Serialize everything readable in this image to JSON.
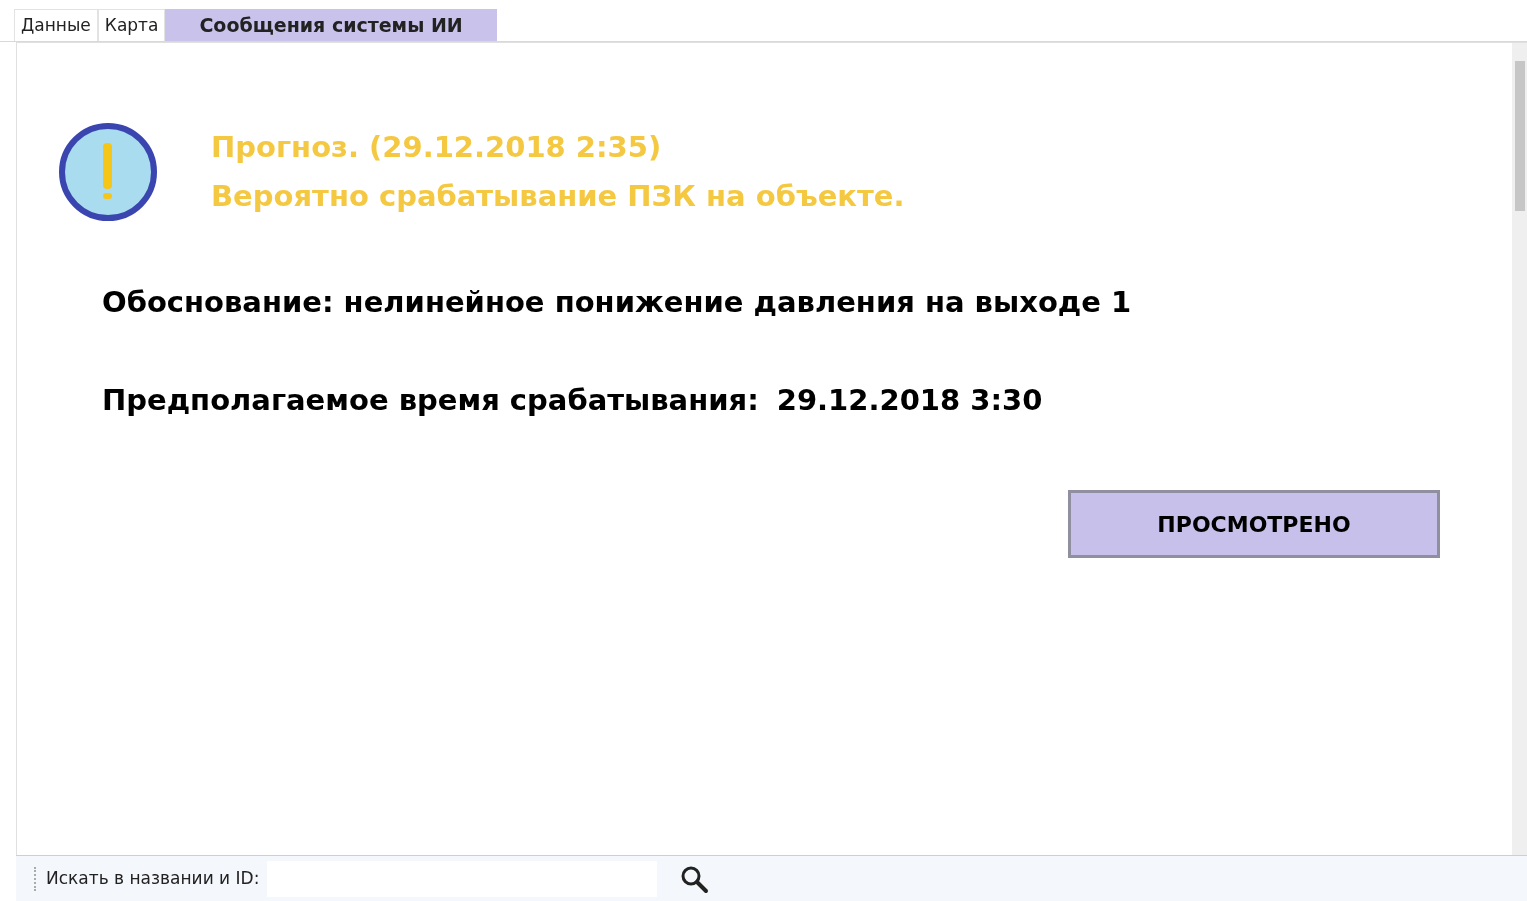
{
  "tabs": [
    {
      "label": "Данные",
      "selected": false
    },
    {
      "label": "Карта",
      "selected": false
    },
    {
      "label": "Сообщения системы ИИ",
      "selected": true
    }
  ],
  "message": {
    "title": "Прогноз. (29.12.2018 2:35)",
    "subtitle": "Вероятно срабатывание ПЗК на объекте.",
    "reason": "Обоснование: нелинейное понижение давления на выходе 1",
    "time_label": "Предполагаемое время срабатывания:",
    "time_value": "29.12.2018 3:30",
    "button": "ПРОСМОТРЕНО"
  },
  "search": {
    "label": "Искать в названии и ID:"
  }
}
